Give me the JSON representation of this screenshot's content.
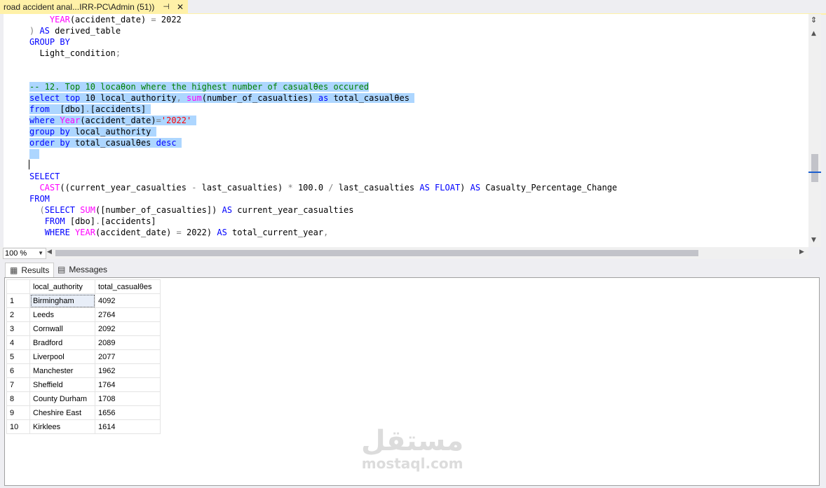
{
  "window": {
    "tab_title": "road accident anal...IRR-PC\\Admin (51))",
    "pin_icon": "pin-icon",
    "close_icon": "close-icon"
  },
  "editor": {
    "lines": [
      [
        {
          "t": "    ",
          "c": ""
        },
        {
          "t": "YEAR",
          "c": "fn"
        },
        {
          "t": "(accident_date) ",
          "c": ""
        },
        {
          "t": "=",
          "c": "gy"
        },
        {
          "t": " 2022",
          "c": ""
        }
      ],
      [
        {
          "t": ") ",
          "c": "gy"
        },
        {
          "t": "AS",
          "c": "kw"
        },
        {
          "t": " derived_table",
          "c": ""
        }
      ],
      [
        {
          "t": "GROUP BY",
          "c": "kw"
        }
      ],
      [
        {
          "t": "  Light_condition",
          "c": ""
        },
        {
          "t": ";",
          "c": "gy"
        }
      ],
      [],
      [],
      [
        {
          "t": "-- 12. Top 10 locaθon where the highest number of casualθes occured",
          "c": "cm",
          "s": true
        }
      ],
      [
        {
          "t": "select",
          "c": "kw",
          "s": true
        },
        {
          "t": " ",
          "c": "",
          "s": true
        },
        {
          "t": "top",
          "c": "kw",
          "s": true
        },
        {
          "t": " 10 local_authority",
          "c": "",
          "s": true
        },
        {
          "t": ",",
          "c": "gy",
          "s": true
        },
        {
          "t": " ",
          "c": "",
          "s": true
        },
        {
          "t": "sum",
          "c": "fn",
          "s": true
        },
        {
          "t": "(number_of_casualties) ",
          "c": "",
          "s": true
        },
        {
          "t": "as",
          "c": "kw",
          "s": true
        },
        {
          "t": " total_casualθes ",
          "c": "",
          "s": true
        }
      ],
      [
        {
          "t": "from",
          "c": "kw",
          "s": true
        },
        {
          "t": "  [dbo]",
          "c": "",
          "s": true
        },
        {
          "t": ".",
          "c": "gy",
          "s": true
        },
        {
          "t": "[accidents] ",
          "c": "",
          "s": true
        }
      ],
      [
        {
          "t": "where",
          "c": "kw",
          "s": true
        },
        {
          "t": " ",
          "c": "",
          "s": true
        },
        {
          "t": "Year",
          "c": "fn",
          "s": true
        },
        {
          "t": "(accident_date)",
          "c": "",
          "s": true
        },
        {
          "t": "=",
          "c": "gy",
          "s": true
        },
        {
          "t": "'2022' ",
          "c": "str",
          "s": true
        }
      ],
      [
        {
          "t": "group",
          "c": "kw",
          "s": true
        },
        {
          "t": " ",
          "c": "",
          "s": true
        },
        {
          "t": "by",
          "c": "kw",
          "s": true
        },
        {
          "t": " local_authority ",
          "c": "",
          "s": true
        }
      ],
      [
        {
          "t": "order",
          "c": "kw",
          "s": true
        },
        {
          "t": " ",
          "c": "",
          "s": true
        },
        {
          "t": "by",
          "c": "kw",
          "s": true
        },
        {
          "t": " total_casualθes ",
          "c": "",
          "s": true
        },
        {
          "t": "desc",
          "c": "kw",
          "s": true
        },
        {
          "t": " ",
          "c": "",
          "s": true
        }
      ],
      [
        {
          "t": "  ",
          "c": "",
          "s": true
        }
      ],
      [],
      [
        {
          "t": "SELECT",
          "c": "kw"
        }
      ],
      [
        {
          "t": "  ",
          "c": ""
        },
        {
          "t": "CAST",
          "c": "fn"
        },
        {
          "t": "((current_year_casualties ",
          "c": ""
        },
        {
          "t": "-",
          "c": "gy"
        },
        {
          "t": " last_casualties) ",
          "c": ""
        },
        {
          "t": "*",
          "c": "gy"
        },
        {
          "t": " 100.0 ",
          "c": ""
        },
        {
          "t": "/",
          "c": "gy"
        },
        {
          "t": " last_casualties ",
          "c": ""
        },
        {
          "t": "AS",
          "c": "kw"
        },
        {
          "t": " ",
          "c": ""
        },
        {
          "t": "FLOAT",
          "c": "kw"
        },
        {
          "t": ") ",
          "c": ""
        },
        {
          "t": "AS",
          "c": "kw"
        },
        {
          "t": " Casualty_Percentage_Change",
          "c": ""
        }
      ],
      [
        {
          "t": "FROM",
          "c": "kw"
        }
      ],
      [
        {
          "t": "  (",
          "c": "gy"
        },
        {
          "t": "SELECT",
          "c": "kw"
        },
        {
          "t": " ",
          "c": ""
        },
        {
          "t": "SUM",
          "c": "fn"
        },
        {
          "t": "([number_of_casualties]) ",
          "c": ""
        },
        {
          "t": "AS",
          "c": "kw"
        },
        {
          "t": " current_year_casualties",
          "c": ""
        }
      ],
      [
        {
          "t": "   ",
          "c": ""
        },
        {
          "t": "FROM",
          "c": "kw"
        },
        {
          "t": " [dbo]",
          "c": ""
        },
        {
          "t": ".",
          "c": "gy"
        },
        {
          "t": "[accidents]",
          "c": ""
        }
      ],
      [
        {
          "t": "   ",
          "c": ""
        },
        {
          "t": "WHERE",
          "c": "kw"
        },
        {
          "t": " ",
          "c": ""
        },
        {
          "t": "YEAR",
          "c": "fn"
        },
        {
          "t": "(accident_date) ",
          "c": ""
        },
        {
          "t": "=",
          "c": "gy"
        },
        {
          "t": " 2022) ",
          "c": ""
        },
        {
          "t": "AS",
          "c": "kw"
        },
        {
          "t": " total_current_year",
          "c": ""
        },
        {
          "t": ",",
          "c": "gy"
        }
      ]
    ]
  },
  "statusbar": {
    "zoom": "100 %"
  },
  "results_tabs": [
    {
      "label": "Results",
      "icon": "grid-icon"
    },
    {
      "label": "Messages",
      "icon": "messages-icon"
    }
  ],
  "grid": {
    "columns": [
      "local_authority",
      "total_casualθes"
    ],
    "rows": [
      [
        "1",
        "Birmingham",
        "4092"
      ],
      [
        "2",
        "Leeds",
        "2764"
      ],
      [
        "3",
        "Cornwall",
        "2092"
      ],
      [
        "4",
        "Bradford",
        "2089"
      ],
      [
        "5",
        "Liverpool",
        "2077"
      ],
      [
        "6",
        "Manchester",
        "1962"
      ],
      [
        "7",
        "Sheffield",
        "1764"
      ],
      [
        "8",
        "County Durham",
        "1708"
      ],
      [
        "9",
        "Cheshire East",
        "1656"
      ],
      [
        "10",
        "Kirklees",
        "1614"
      ]
    ]
  },
  "watermark": {
    "arabic": "مستقل",
    "latin": "mostaql.com"
  }
}
